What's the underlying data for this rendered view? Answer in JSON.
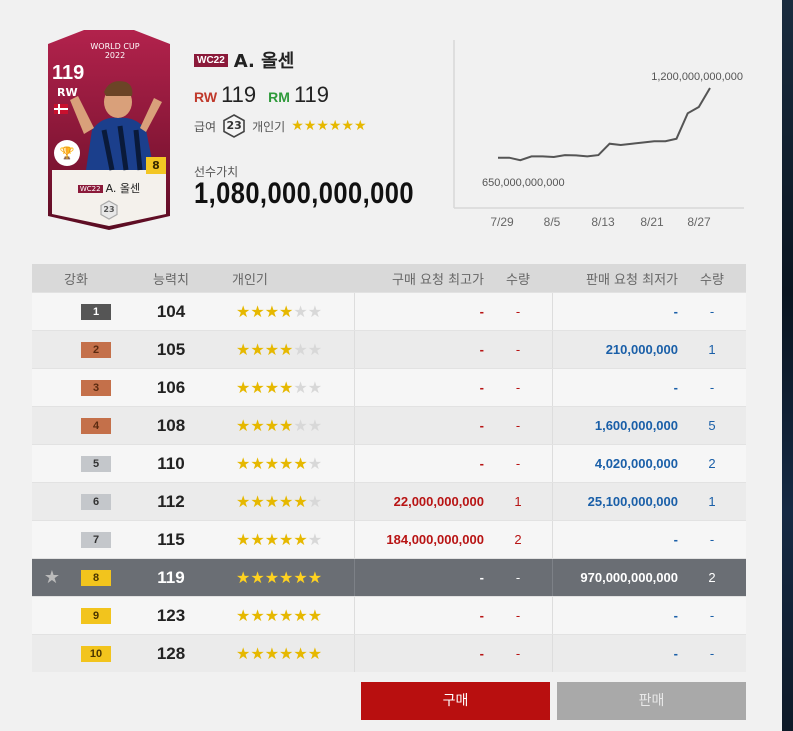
{
  "card": {
    "event_line1": "WORLD CUP",
    "event_line2": "2022",
    "ovr": "119",
    "position": "RW",
    "level": "8",
    "season_tag": "WC22",
    "name": "A. 올센",
    "salary": "23"
  },
  "player": {
    "season_tag": "WC22",
    "name": "A. 올센",
    "pos1_label": "RW",
    "pos1_value": "119",
    "pos2_label": "RM",
    "pos2_value": "119",
    "salary_label": "급여",
    "salary_value": "23",
    "skill_label": "개인기",
    "skill_stars": "★★★★★★",
    "value_label": "선수가치",
    "value": "1,080,000,000,000"
  },
  "chart_data": {
    "type": "line",
    "x_ticks": [
      "7/29",
      "8/5",
      "8/13",
      "8/21",
      "8/27"
    ],
    "annotations": [
      "1,200,000,000,000",
      "650,000,000,000"
    ],
    "ymax_label": "1,200,000,000,000",
    "ymin_label": "650,000,000,000",
    "values": [
      650,
      650,
      630,
      660,
      660,
      655,
      670,
      668,
      660,
      670,
      760,
      750,
      760,
      770,
      780,
      780,
      800,
      1000,
      1050,
      1200
    ]
  },
  "table": {
    "headers": [
      "강화",
      "능력치",
      "개인기",
      "구매 요청 최고가",
      "수량",
      "판매 요청 최저가",
      "수량"
    ],
    "rows": [
      {
        "level": "1",
        "power": "104",
        "stars": 4,
        "buy": "-",
        "buy_qty": "-",
        "sell": "-",
        "sell_qty": "-"
      },
      {
        "level": "2",
        "power": "105",
        "stars": 4,
        "buy": "-",
        "buy_qty": "-",
        "sell": "210,000,000",
        "sell_qty": "1"
      },
      {
        "level": "3",
        "power": "106",
        "stars": 4,
        "buy": "-",
        "buy_qty": "-",
        "sell": "-",
        "sell_qty": "-"
      },
      {
        "level": "4",
        "power": "108",
        "stars": 4,
        "buy": "-",
        "buy_qty": "-",
        "sell": "1,600,000,000",
        "sell_qty": "5"
      },
      {
        "level": "5",
        "power": "110",
        "stars": 5,
        "buy": "-",
        "buy_qty": "-",
        "sell": "4,020,000,000",
        "sell_qty": "2"
      },
      {
        "level": "6",
        "power": "112",
        "stars": 5,
        "buy": "22,000,000,000",
        "buy_qty": "1",
        "sell": "25,100,000,000",
        "sell_qty": "1"
      },
      {
        "level": "7",
        "power": "115",
        "stars": 5,
        "buy": "184,000,000,000",
        "buy_qty": "2",
        "sell": "-",
        "sell_qty": "-"
      },
      {
        "level": "8",
        "power": "119",
        "stars": 6,
        "buy": "-",
        "buy_qty": "-",
        "sell": "970,000,000,000",
        "sell_qty": "2"
      },
      {
        "level": "9",
        "power": "123",
        "stars": 6,
        "buy": "-",
        "buy_qty": "-",
        "sell": "-",
        "sell_qty": "-"
      },
      {
        "level": "10",
        "power": "128",
        "stars": 6,
        "buy": "-",
        "buy_qty": "-",
        "sell": "-",
        "sell_qty": "-"
      }
    ]
  },
  "buttons": {
    "buy": "구매",
    "sell": "판매"
  }
}
